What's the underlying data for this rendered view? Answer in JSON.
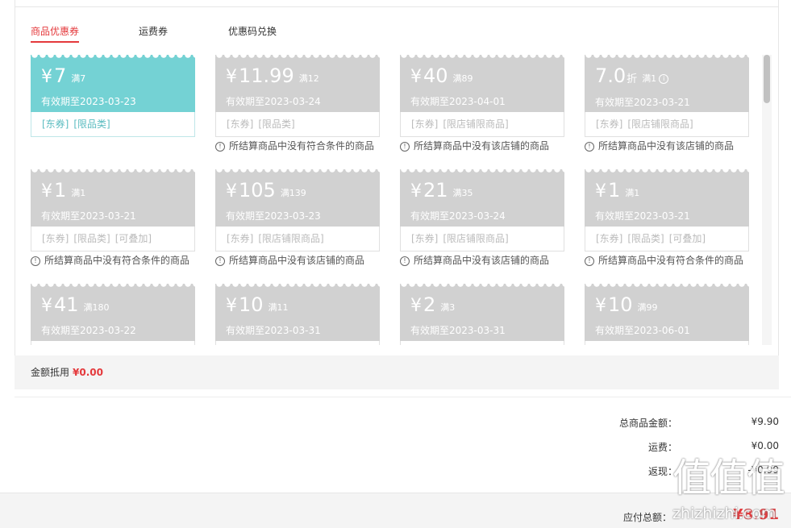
{
  "tabs": [
    {
      "label": "商品优惠券",
      "active": true
    },
    {
      "label": "运费券",
      "active": false
    },
    {
      "label": "优惠码兑换",
      "active": false
    }
  ],
  "coupons": [
    {
      "amount": "7",
      "currency": "¥",
      "cond": "满7",
      "valid": "有效期至2023-03-23",
      "tags": [
        "[东券]",
        "[限品类]"
      ],
      "reason": "",
      "active": true
    },
    {
      "amount": "11.99",
      "currency": "¥",
      "cond": "满12",
      "valid": "有效期至2023-03-24",
      "tags": [
        "[东券]",
        "[限品类]"
      ],
      "reason": "所结算商品中没有符合条件的商品",
      "active": false
    },
    {
      "amount": "40",
      "currency": "¥",
      "cond": "满89",
      "valid": "有效期至2023-04-01",
      "tags": [
        "[东券]",
        "[限店铺限商品]"
      ],
      "reason": "所结算商品中没有该店铺的商品",
      "active": false
    },
    {
      "amount": "7.0",
      "currency": "",
      "unit": "折",
      "cond": "满1",
      "info": "i",
      "valid": "有效期至2023-03-21",
      "tags": [
        "[东券]",
        "[限店铺限商品]"
      ],
      "reason": "所结算商品中没有该店铺的商品",
      "active": false
    },
    {
      "amount": "1",
      "currency": "¥",
      "cond": "满1",
      "valid": "有效期至2023-03-21",
      "tags": [
        "[东券]",
        "[限品类]",
        "[可叠加]"
      ],
      "reason": "所结算商品中没有符合条件的商品",
      "active": false
    },
    {
      "amount": "105",
      "currency": "¥",
      "cond": "满139",
      "valid": "有效期至2023-03-23",
      "tags": [
        "[东券]",
        "[限店铺限商品]"
      ],
      "reason": "所结算商品中没有该店铺的商品",
      "active": false
    },
    {
      "amount": "21",
      "currency": "¥",
      "cond": "满35",
      "valid": "有效期至2023-03-24",
      "tags": [
        "[东券]",
        "[限店铺限商品]"
      ],
      "reason": "所结算商品中没有该店铺的商品",
      "active": false
    },
    {
      "amount": "1",
      "currency": "¥",
      "cond": "满1",
      "valid": "有效期至2023-03-21",
      "tags": [
        "[东券]",
        "[限品类]",
        "[可叠加]"
      ],
      "reason": "所结算商品中没有符合条件的商品",
      "active": false
    },
    {
      "amount": "41",
      "currency": "¥",
      "cond": "满180",
      "valid": "有效期至2023-03-22",
      "tags": [],
      "reason": "",
      "active": false
    },
    {
      "amount": "10",
      "currency": "¥",
      "cond": "满11",
      "valid": "有效期至2023-03-31",
      "tags": [],
      "reason": "",
      "active": false
    },
    {
      "amount": "2",
      "currency": "¥",
      "cond": "满3",
      "valid": "有效期至2023-03-31",
      "tags": [],
      "reason": "",
      "active": false
    },
    {
      "amount": "10",
      "currency": "¥",
      "cond": "满99",
      "valid": "有效期至2023-06-01",
      "tags": [],
      "reason": "",
      "active": false
    }
  ],
  "reason_icon": "!",
  "summary": {
    "label": "金额抵用",
    "value": "¥0.00"
  },
  "totals": [
    {
      "label": "总商品金额：",
      "value": "¥9.90"
    },
    {
      "label": "运费：",
      "value": "¥0.00"
    },
    {
      "label": "返现：",
      "value": "-¥0.99"
    }
  ],
  "pay": {
    "label": "应付总额：",
    "value": "¥8.91"
  },
  "watermark": {
    "glyphs": "值值值",
    "text": "zhizhizhi.com"
  },
  "colors": {
    "accent": "#e4393c",
    "coupon_active": "#74d2d4",
    "coupon_disabled": "#d1d1d1"
  }
}
